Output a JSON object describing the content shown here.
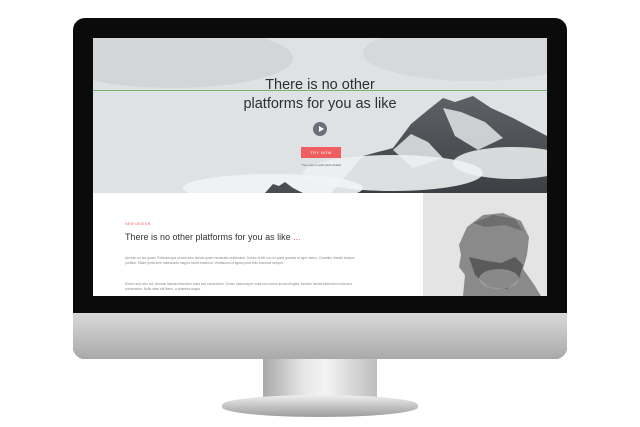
{
  "hero": {
    "title_line1": "There is no other",
    "title_line2": "platforms for you as like",
    "play_icon": "play-icon",
    "cta_label": "TRY NOW",
    "hint": "* No need to add cards details"
  },
  "section": {
    "tag": "NEW DESIGN",
    "title": "There is no other platforms for you as like",
    "title_suffix": "...",
    "paragraph1": "Aenean eu leo quam. Pellentesque ornare sem lacinia quam venenatis vestibulum. Donec id elit non mi porta gravida at eget metus. Curabitur blandit tempus porttitor. Etiam porta sem malesuada magna mollis euismod. Vestibulum id ligula porta felis euismod semper.",
    "paragraph2": "Donec sed odio dui. Aenean lacinia bibendum nulla sed consectetur. Donec ullamcorper nulla non metus auctor fringilla. Aenean lacinia bibendum nulla sed consectetur. Nulla vitae elit libero, a pharetra augue."
  },
  "colors": {
    "accent": "#ef5f62",
    "line": "#7db366",
    "bezel": "#0b0b0b"
  }
}
